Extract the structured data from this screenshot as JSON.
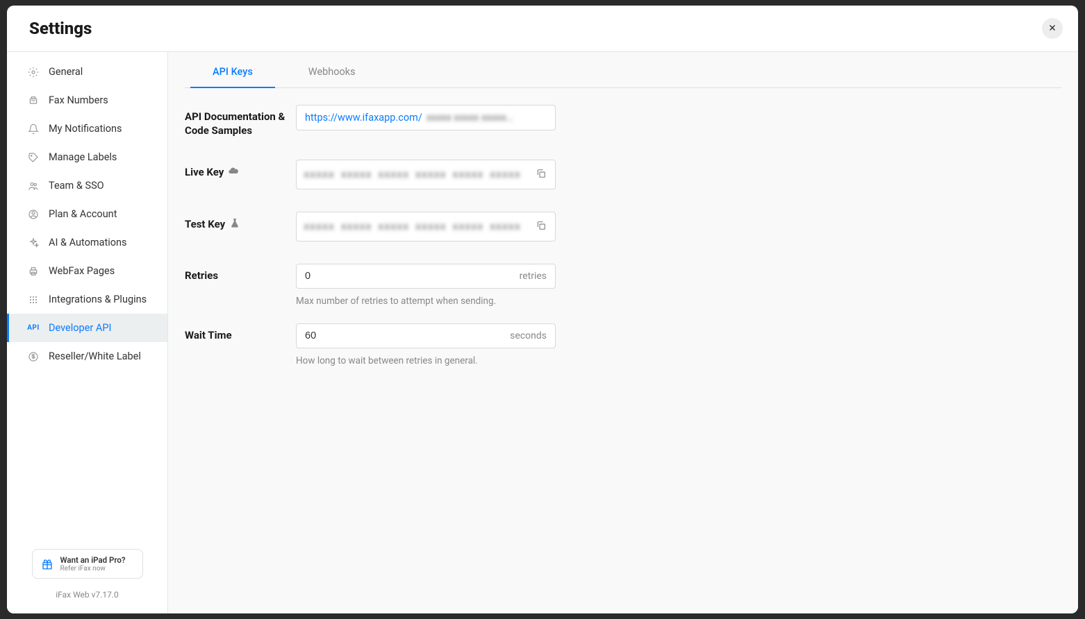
{
  "title": "Settings",
  "sidebar": {
    "items": [
      {
        "label": "General"
      },
      {
        "label": "Fax Numbers"
      },
      {
        "label": "My Notifications"
      },
      {
        "label": "Manage Labels"
      },
      {
        "label": "Team & SSO"
      },
      {
        "label": "Plan & Account"
      },
      {
        "label": "AI & Automations"
      },
      {
        "label": "WebFax Pages"
      },
      {
        "label": "Integrations & Plugins"
      },
      {
        "label": "Developer API"
      },
      {
        "label": "Reseller/White Label"
      }
    ],
    "promo": {
      "title": "Want an iPad Pro?",
      "subtitle": "Refer iFax now"
    },
    "version": "iFax Web v7.17.0"
  },
  "tabs": {
    "apiKeys": "API Keys",
    "webhooks": "Webhooks"
  },
  "form": {
    "docLabel": "API Documentation & Code Samples",
    "docLinkPrefix": "https://www.ifaxapp.com/",
    "docLinkBlurred": "xxxxx xxxxx xxxxx…",
    "liveKeyLabel": "Live Key",
    "liveKeyValue": "xxxxx xxxxx xxxxx xxxxx xxxxx xxxxx",
    "testKeyLabel": "Test Key",
    "testKeyValue": "xxxxx xxxxx xxxxx xxxxx xxxxx xxxxx",
    "retriesLabel": "Retries",
    "retriesValue": "0",
    "retriesUnit": "retries",
    "retriesHelp": "Max number of retries to attempt when sending.",
    "waitTimeLabel": "Wait Time",
    "waitTimeValue": "60",
    "waitTimeUnit": "seconds",
    "waitTimeHelp": "How long to wait between retries in general."
  }
}
